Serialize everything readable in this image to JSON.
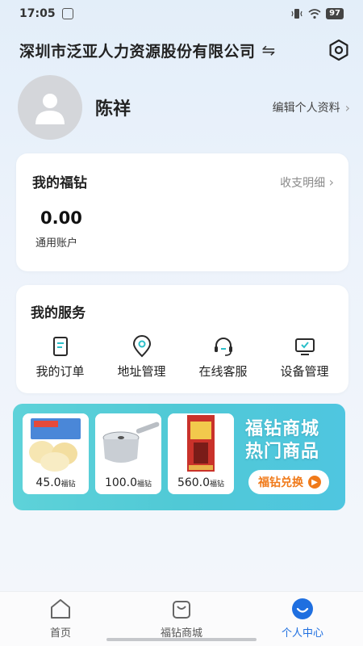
{
  "status_bar": {
    "time": "17:05",
    "battery": "97"
  },
  "header": {
    "company": "深圳市泛亚人力资源股份有限公司"
  },
  "profile": {
    "name": "陈祥",
    "edit_label": "编辑个人资料"
  },
  "fuzuan_card": {
    "title": "我的福钻",
    "link": "收支明细",
    "balance": "0.00",
    "balance_label": "通用账户"
  },
  "services": {
    "title": "我的服务",
    "items": [
      {
        "label": "我的订单",
        "icon": "order-icon"
      },
      {
        "label": "地址管理",
        "icon": "location-icon"
      },
      {
        "label": "在线客服",
        "icon": "headset-icon"
      },
      {
        "label": "设备管理",
        "icon": "monitor-icon"
      }
    ]
  },
  "banner": {
    "title_line1": "福钻商城",
    "title_line2": "热门商品",
    "button": "福钻兑换",
    "products": [
      {
        "price": "45.0",
        "unit": "福钻"
      },
      {
        "price": "100.0",
        "unit": "福钻"
      },
      {
        "price": "560.0",
        "unit": "福钻"
      }
    ]
  },
  "tabbar": {
    "tabs": [
      {
        "label": "首页"
      },
      {
        "label": "福钻商城"
      },
      {
        "label": "个人中心"
      }
    ],
    "active_color": "#1f6fe0"
  }
}
